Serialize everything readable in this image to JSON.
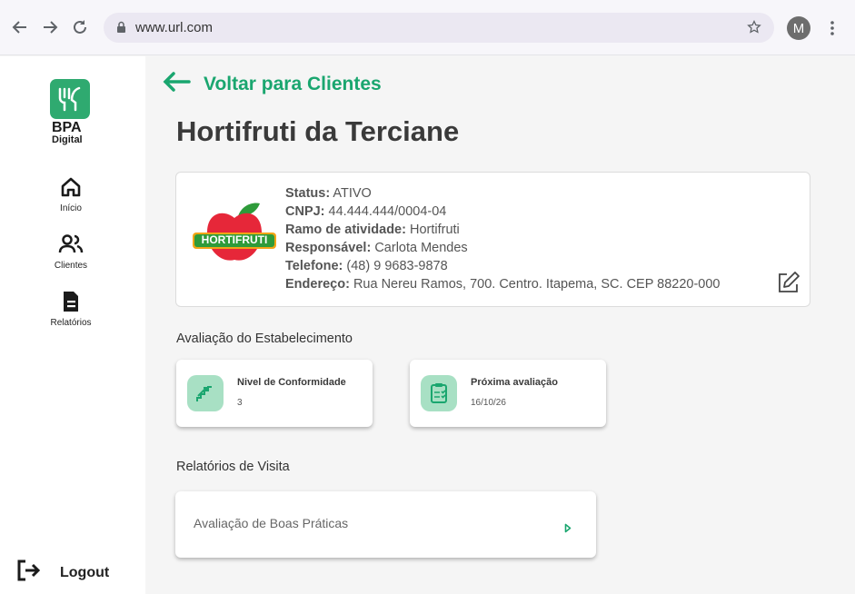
{
  "browser": {
    "url": "www.url.com",
    "avatar_letter": "M"
  },
  "sidebar": {
    "brand_line1": "BPA",
    "brand_line2": "Digital",
    "items": [
      {
        "label": "Início",
        "icon": "home-icon",
        "active": false
      },
      {
        "label": "Clientes",
        "icon": "users-icon",
        "active": true
      },
      {
        "label": "Relatórios",
        "icon": "document-icon",
        "active": false
      }
    ],
    "logout_label": "Logout"
  },
  "main": {
    "back_label": "Voltar para Clientes",
    "title": "Hortifruti da Terciane",
    "client_logo_text": "HORTIFRUTI",
    "info": {
      "status_label": "Status:",
      "status_value": "ATIVO",
      "cnpj_label": "CNPJ:",
      "cnpj_value": "44.444.444/0004-04",
      "ramo_label": "Ramo de atividade:",
      "ramo_value": "Hortifruti",
      "responsavel_label": "Responsável:",
      "responsavel_value": "Carlota Mendes",
      "telefone_label": "Telefone:",
      "telefone_value": "(48) 9 9683-9878",
      "endereco_label": "Endereço:",
      "endereco_value": "Rua Nereu Ramos, 700. Centro. Itapema, SC. CEP 88220-000"
    },
    "evaluation_section": "Avaliação do Estabelecimento",
    "kpis": [
      {
        "title": "Nivel de Conformidade",
        "value": "3",
        "icon": "stairs-trend-icon"
      },
      {
        "title": "Próxima avaliação",
        "value": "16/10/26",
        "icon": "clipboard-check-icon"
      }
    ],
    "reports_section": "Relatórios de Visita",
    "reports": [
      {
        "label": "Avaliação de Boas Práticas"
      }
    ]
  },
  "colors": {
    "accent": "#1aa66f",
    "accent_light": "#a8e0c4",
    "logo_green": "#2faa70"
  }
}
